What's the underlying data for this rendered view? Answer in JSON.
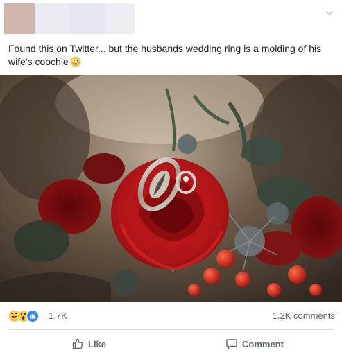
{
  "post": {
    "caption": "Found this on Twitter... but the husbands wedding ring is a molding of his wife's coochie",
    "caption_emoji_icon": "flushed-face-icon",
    "photo_icon": "ring-in-rose-photo",
    "colors": {
      "text": "#1c1e21",
      "meta_text": "#606770",
      "like_blue": "#2d88ff",
      "emoji_yellow": "#f7c948",
      "divider": "#dadde1"
    }
  },
  "stats": {
    "reactions": [
      "haha-reaction-icon",
      "wow-reaction-icon",
      "like-reaction-icon"
    ],
    "reaction_count": "1.7K",
    "comments_count": "1.2K comments"
  },
  "actions": {
    "like_label": "Like",
    "comment_label": "Comment"
  }
}
